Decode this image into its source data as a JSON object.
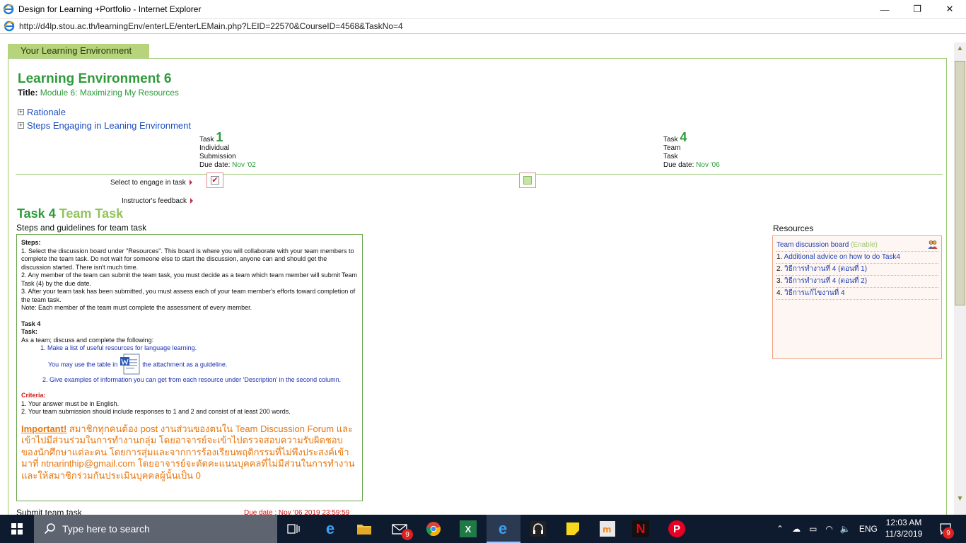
{
  "window": {
    "title": "Design for Learning +Portfolio - Internet Explorer",
    "url": "http://d4lp.stou.ac.th/learningEnv/enterLE/enterLEMain.php?LEID=22570&CourseID=4568&TaskNo=4",
    "min_glyph": "—",
    "max_glyph": "❐",
    "close_glyph": "✕"
  },
  "page": {
    "tab_label": "Your Learning Environment",
    "le_title": "Learning Environment 6",
    "title_label": "Title:",
    "title_value": "Module 6: Maximizing My Resources",
    "rationale": "Rationale",
    "steps_engaging": "Steps Engaging in Leaning Environment",
    "expand_glyph": "+",
    "tasks": [
      {
        "label": "Task",
        "number": "1",
        "line1": "Individual",
        "line2": "Submission",
        "due_label": "Due date:",
        "due": "Nov '02"
      },
      {
        "label": "Task",
        "number": "4",
        "line1": "Team",
        "line2": "Task",
        "due_label": "Due date:",
        "due": "Nov '06"
      }
    ],
    "select_label": "Select to engage in task",
    "feedback_label": "Instructor's feedback",
    "check_glyph": "✔",
    "task_heading_num": "Task 4",
    "task_heading_name": "Team Task",
    "steps_title": "Steps and guidelines for team task",
    "steps": {
      "steps_hdr": "Steps:",
      "s1": "1. Select the discussion board under \"Resources\". This board is where you will collaborate with your team members to complete the team task. Do not wait for someone else to start the discussion, anyone can and should get the discussion started. There isn't much time.",
      "s2": "2. Any member of the team can submit the team task, you must decide as a team which team member will submit Team Task (4) by the due date.",
      "s3": "3. After your team task has been submitted, you must assess each of your team member's efforts toward completion of the team task.",
      "note": "Note: Each member of the team must complete the assessment of every member.",
      "task4_hdr": "Task 4",
      "task_hdr": "Task:",
      "intro": "As a team; discuss and complete the following:",
      "i1": "1. Make a list of useful resources for language learning.",
      "i1b_pre": "You may use the table in",
      "i1b_post": "the attachment as a guideline.",
      "i2": "2. Give examples of information you can get from each resource under 'Description' in the second column.",
      "criteria_hdr": "Criteria:",
      "c1": "1. Your answer must be in English.",
      "c2": "2. Your team submission should include responses to 1 and 2 and consist of at least 200 words.",
      "important_label": "Important!",
      "important_text": "สมาชิกทุกคนต้อง post งานส่วนของตนใน Team Discussion Forum และเข้าไปมีส่วนร่วมในการทำงานกลุ่ม โดยอาจารย์จะเข้าไปตรวจสอบความรับผิดชอบของนักศึกษาแต่ละคน โดยการสุ่มและจากการร้องเรียนพฤติกรรมที่ไม่พึงประสงค์เข้ามาที่ ntnarinthip@gmail.com โดยอาจารย์จะตัดคะแนนบุคคลที่ไม่มีส่วนในการทำงาน และให้สมาชิกร่วมกันประเมินบุคคลผู้นั้นเป็น 0"
    },
    "resources": {
      "title": "Resources",
      "board_label": "Team discussion board",
      "board_status": "(Enable)",
      "items": [
        {
          "num": "1.",
          "text": "Additional advice on how to do Task4"
        },
        {
          "num": "2.",
          "text": "วิธีการทำงานที่ 4 (ตอนที่ 1)"
        },
        {
          "num": "3.",
          "text": "วิธีการทำงานที่ 4 (ตอนที่ 2)"
        },
        {
          "num": "4.",
          "text": "วิธีการแก้ไขงานที่ 4"
        }
      ]
    },
    "submit_label": "Submit team task",
    "submit_due": "Due date : Nov '06 2019 23:59:59"
  },
  "taskbar": {
    "search_placeholder": "Type here to search",
    "mail_badge": "9",
    "notify_badge": "9",
    "lang": "ENG",
    "time": "12:03 AM",
    "date": "11/3/2019",
    "netflix": "N",
    "excel": "X",
    "edge": "e",
    "ie": "e",
    "chrome": "",
    "pinterest": "P"
  }
}
